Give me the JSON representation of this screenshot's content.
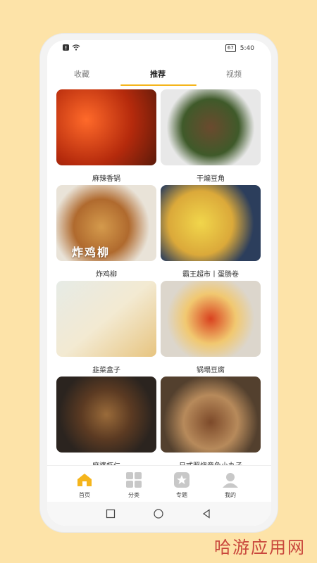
{
  "status": {
    "time": "5:40",
    "battery": "67"
  },
  "tabs": [
    {
      "label": "收藏"
    },
    {
      "label": "推荐"
    },
    {
      "label": "视频"
    }
  ],
  "cards": [
    {
      "caption": "麻辣香锅"
    },
    {
      "caption": "干煸豆角"
    },
    {
      "caption": "炸鸡柳",
      "overlay": "炸鸡柳"
    },
    {
      "caption": "霸王超市丨蛋肠卷"
    },
    {
      "caption": "韭菜盒子"
    },
    {
      "caption": "锅塌豆腐"
    },
    {
      "caption": "麻婆虾仁"
    },
    {
      "caption": "日式照烧章鱼小丸子"
    }
  ],
  "nav": [
    {
      "label": "首页",
      "icon": "home-icon"
    },
    {
      "label": "分类",
      "icon": "grid-icon"
    },
    {
      "label": "专题",
      "icon": "star-icon"
    },
    {
      "label": "我的",
      "icon": "user-icon"
    }
  ],
  "colors": {
    "accent": "#f5b51c",
    "background": "#fde3a8",
    "watermark": "#c9473c"
  },
  "watermark": "哈游应用网"
}
